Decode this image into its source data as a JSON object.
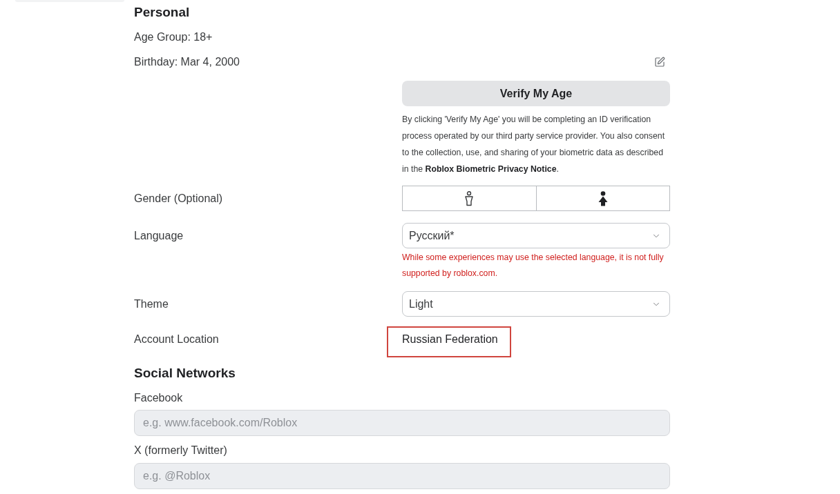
{
  "personal": {
    "heading": "Personal",
    "age_group": "Age Group: 18+",
    "birthday": "Birthday: Mar 4, 2000",
    "verify_button": "Verify My Age",
    "verify_notice": {
      "text": "By clicking 'Verify My Age' you will be completing an ID verification process operated by our third party service provider. You also consent to the collection, use, and sharing of your biometric data as described in the",
      "link": "Roblox Biometric Privacy Notice",
      "after": "."
    },
    "gender": {
      "label": "Gender (Optional)",
      "options": [
        {
          "selected": false
        },
        {
          "selected": false
        }
      ]
    },
    "language": {
      "label": "Language",
      "value": "Русский*",
      "warning": "While some experiences may use the selected language, it is not fully supported by roblox.com."
    },
    "theme": {
      "label": "Theme",
      "value": "Light"
    },
    "account_location": {
      "label": "Account Location",
      "value": "Russian Federation",
      "highlighted": true
    }
  },
  "social_networks": {
    "heading": "Social Networks",
    "fields": [
      {
        "label": "Facebook",
        "placeholder": "e.g. www.facebook.com/Roblox"
      },
      {
        "label": "X (formerly Twitter)",
        "placeholder": "e.g. @Roblox"
      }
    ]
  }
}
